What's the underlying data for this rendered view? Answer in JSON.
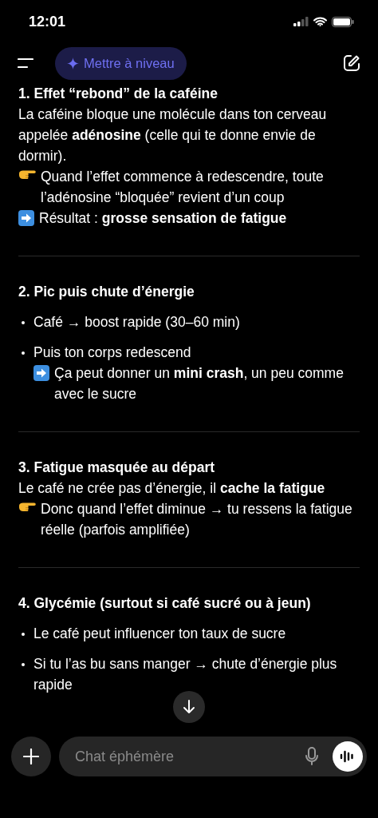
{
  "status_bar": {
    "time": "12:01"
  },
  "header": {
    "upgrade_button": "Mettre à niveau"
  },
  "sections": [
    {
      "title": "1. Effet “rebond” de la caféine",
      "blocks": [
        {
          "kind": "text",
          "text": "La caféine bloque une molécule dans ton cerveau appelée **adénosine** (celle qui te donne envie de dormir)."
        },
        {
          "kind": "pointer",
          "text": "Quand l’effet commence à redescendre, toute l’adénosine “bloquée” revient d’un coup"
        },
        {
          "kind": "arrow",
          "text": "Résultat : **grosse sensation de fatigue**"
        }
      ]
    },
    {
      "title": "2. Pic puis chute d’énergie",
      "blocks": [
        {
          "kind": "bullet",
          "text": "Café → boost rapide (30–60 min)"
        },
        {
          "kind": "bullet",
          "text": "Puis ton corps redescend",
          "sub": {
            "kind": "arrow",
            "text": "Ça peut donner un **mini crash**, un peu comme avec le sucre"
          }
        }
      ]
    },
    {
      "title": "3. Fatigue masquée au départ",
      "blocks": [
        {
          "kind": "text",
          "text": "Le café ne crée pas d’énergie, il **cache la fatigue**"
        },
        {
          "kind": "pointer",
          "text": "Donc quand l’effet diminue → tu ressens la fatigue réelle (parfois amplifiée)"
        }
      ]
    },
    {
      "title": "4. Glycémie (surtout si café sucré ou à jeun)",
      "blocks": [
        {
          "kind": "bullet",
          "text": "Le café peut influencer ton taux de sucre"
        },
        {
          "kind": "bullet",
          "text": "Si tu l’as bu sans manger → chute d’énergie plus rapide"
        }
      ]
    }
  ],
  "composer": {
    "placeholder": "Chat éphémère"
  }
}
